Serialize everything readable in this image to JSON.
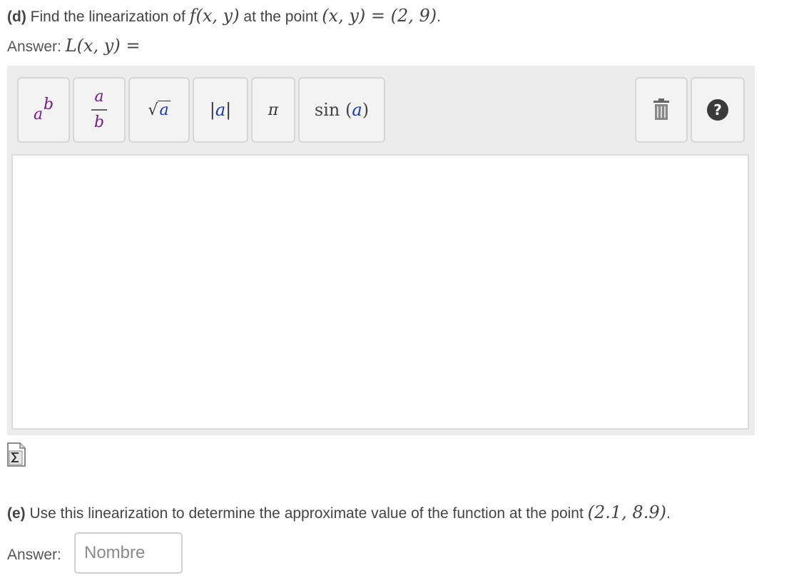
{
  "part_d": {
    "label": "(d)",
    "text_before": " Find the linearization of ",
    "func": "f(x, y)",
    "text_mid": " at the point ",
    "point": "(x, y) = (2, 9)",
    "text_end": ".",
    "answer_label": "Answer: ",
    "answer_expr": "L(x, y) ="
  },
  "toolbar": {
    "power": {
      "base": "a",
      "exp": "b"
    },
    "fraction": {
      "num": "a",
      "den": "b"
    },
    "sqrt": {
      "radical": "√",
      "arg": "a"
    },
    "abs": {
      "left": "|",
      "arg": "a",
      "right": "|"
    },
    "pi": "π",
    "sin": {
      "fn": "sin",
      "open": "(",
      "arg": "a",
      "close": ")"
    },
    "help": "?"
  },
  "part_e": {
    "label": "(e)",
    "text": " Use this linearization to determine the approximate value of the function at the point ",
    "point": "(2.1, 8.9)",
    "text_end": ".",
    "answer_label": "Answer: ",
    "input_placeholder": "Nombre",
    "input_value": ""
  },
  "colors": {
    "accent_purple": "#7b1a8c",
    "accent_blue": "#1a37b8",
    "toolbar_bg": "#ececec"
  },
  "icons": [
    "sigma-icon",
    "trash-icon",
    "help-icon"
  ]
}
